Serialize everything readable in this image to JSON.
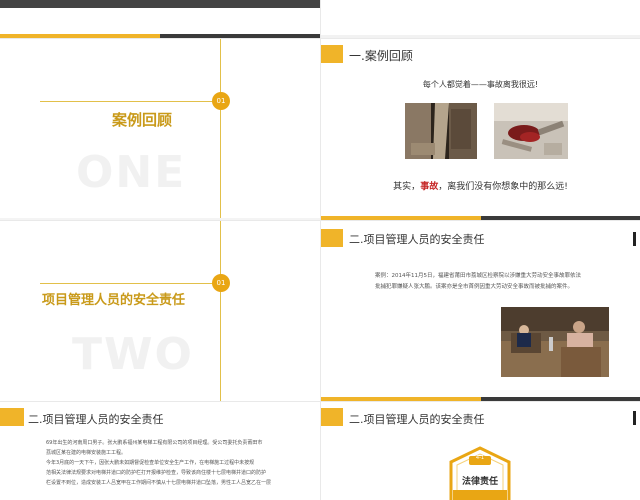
{
  "colors": {
    "accent": "#f0b429",
    "accent_dark": "#c99a1a",
    "dark": "#3a3a3a",
    "danger": "#c62828"
  },
  "slide1": {
    "number": "01",
    "title": "案例回顾",
    "watermark": "ONE"
  },
  "slide2": {
    "header": "一.案例回顾",
    "quote": "每个人都觉着——事故离我很远!",
    "closing_prefix": "其实，",
    "closing_highlight": "事故",
    "closing_suffix": "，离我们没有你想象中的那么远!"
  },
  "slide3": {
    "number": "01",
    "title": "项目管理人员的安全责任",
    "watermark": "TWO"
  },
  "slide4": {
    "header": "二.项目管理人员的安全责任",
    "case_line1": "案例：2014年11月5日，福建省莆田市荔城区检察院以涉嫌重大劳动安全事故罪依法",
    "case_line2": "批捕犯罪嫌疑人张大鹏。该案亦是全市首例因重大劳动安全事故而被批捕的案件。"
  },
  "slide5": {
    "header": "二.项目管理人员的安全责任",
    "lines": [
      "69年出生的河南周口男子。张大鹏系福州某电梯工程有限公司的项目经理。受公司委托负责莆田市",
      "荔城区某在建的电梯安装施工工程。",
      "今年3月底的一天下午，因张大鹏未如期督促检查单位安全生产工作，在电梯施工过程中未按规",
      "范相关法律法规要求对电梯井道口的防护栏打开报维护检查，导致该商住楼十七层电梯井道口的防护",
      "栏设置不到位，造成安装工人吕宽甲在工作期间不慎从十七层电梯井道口坠落，男性工人吕宽乙在一层"
    ]
  },
  "slide6": {
    "header": "二.项目管理人员的安全责任",
    "badge_top": "4-1",
    "badge_label": "法律责任"
  }
}
